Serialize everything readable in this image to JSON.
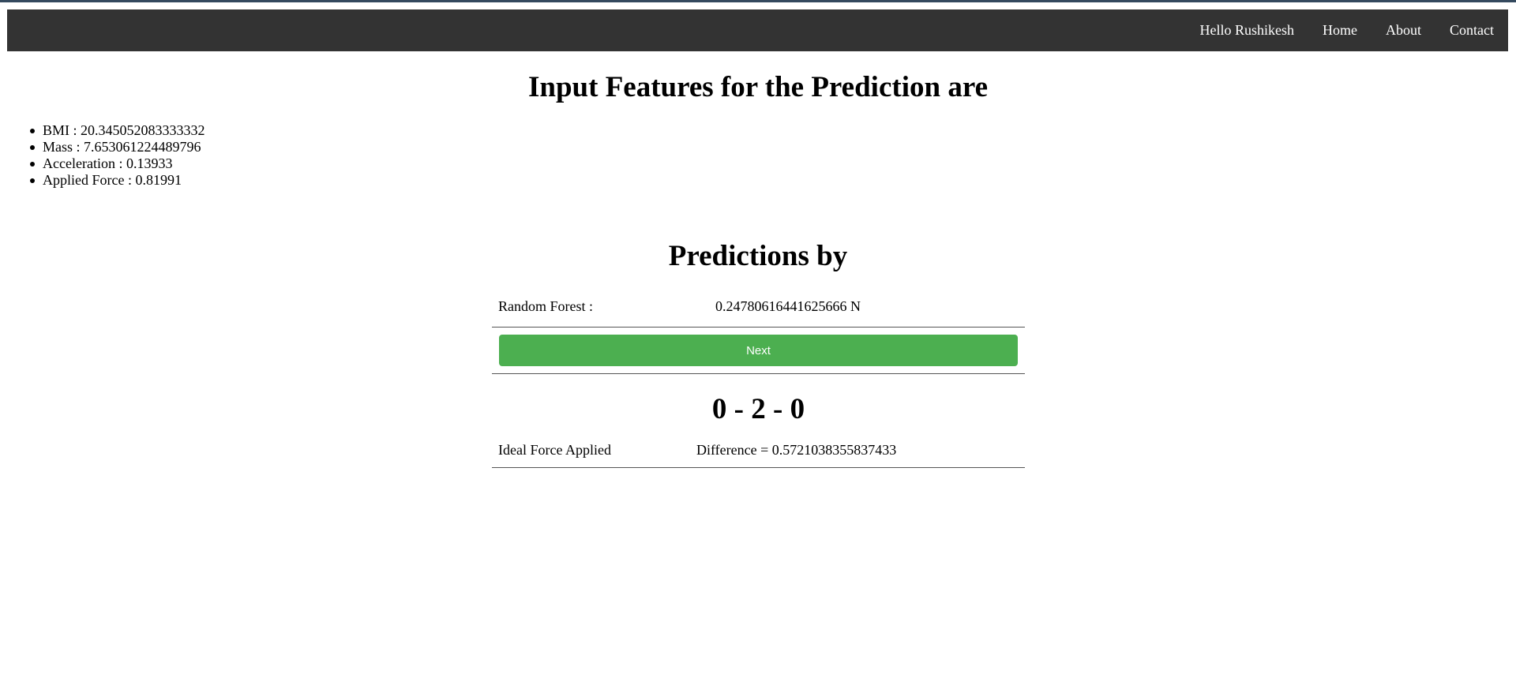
{
  "nav": {
    "greeting": "Hello Rushikesh",
    "links": [
      "Home",
      "About",
      "Contact"
    ]
  },
  "page": {
    "title": "Input Features for the Prediction are",
    "features": [
      "BMI : 20.345052083333332",
      "Mass : 7.653061224489796",
      "Acceleration : 0.13933",
      "Applied Force : 0.81991"
    ],
    "predictions_title": "Predictions by"
  },
  "predictions": {
    "model_label": "Random Forest :",
    "model_value": "0.24780616441625666 N",
    "next_label": "Next",
    "score": "0 - 2 - 0",
    "ideal_label": "Ideal Force Applied",
    "difference": "Difference = 0.5721038355837433"
  },
  "colors": {
    "navbar": "#333333",
    "button": "#4caf50"
  }
}
